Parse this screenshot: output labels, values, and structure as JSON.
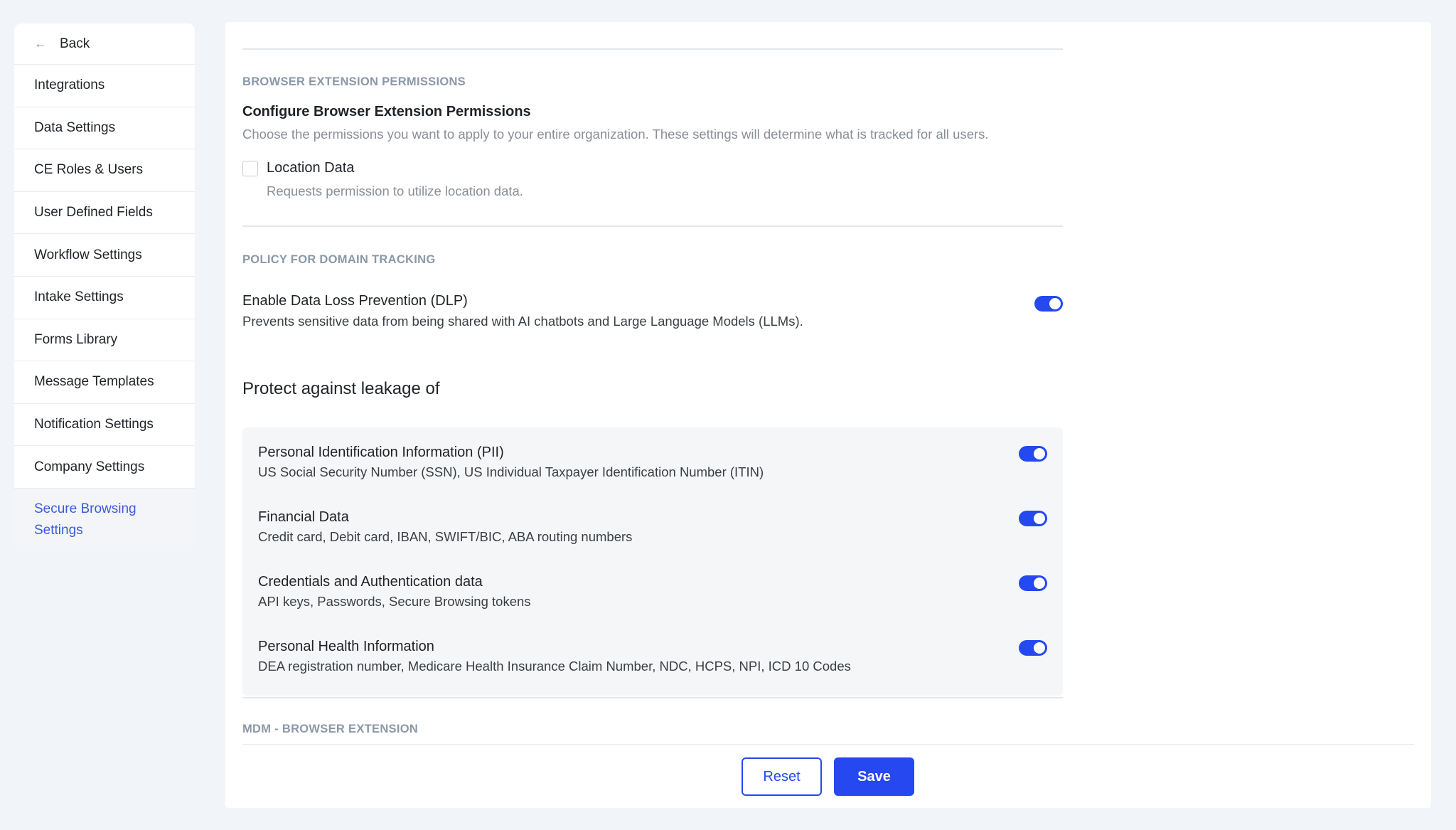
{
  "sidebar": {
    "back_label": "Back",
    "items": [
      {
        "label": "Integrations"
      },
      {
        "label": "Data Settings"
      },
      {
        "label": "CE Roles & Users"
      },
      {
        "label": "User Defined Fields"
      },
      {
        "label": "Workflow Settings"
      },
      {
        "label": "Intake Settings"
      },
      {
        "label": "Forms Library"
      },
      {
        "label": "Message Templates"
      },
      {
        "label": "Notification Settings"
      },
      {
        "label": "Company Settings"
      }
    ],
    "active_item": {
      "line1": "Secure Browsing",
      "line2": "Settings"
    }
  },
  "extension_permissions": {
    "section_label": "BROWSER EXTENSION PERMISSIONS",
    "title": "Configure Browser Extension Permissions",
    "description": "Choose the permissions you want to apply to your entire organization. These settings will determine what is tracked for all users.",
    "location": {
      "label": "Location Data",
      "description": "Requests permission to utilize location data.",
      "checked": false
    }
  },
  "domain_tracking": {
    "section_label": "POLICY FOR DOMAIN TRACKING",
    "dlp": {
      "title": "Enable Data Loss Prevention (DLP)",
      "description": "Prevents sensitive data from being shared with AI chatbots and Large Language Models (LLMs).",
      "enabled": true
    },
    "protect_heading": "Protect against leakage of",
    "items": [
      {
        "title": "Personal Identification Information (PII)",
        "description": "US Social Security Number (SSN), US Individual Taxpayer Identification Number (ITIN)",
        "enabled": true
      },
      {
        "title": "Financial Data",
        "description": "Credit card, Debit card, IBAN, SWIFT/BIC, ABA routing numbers",
        "enabled": true
      },
      {
        "title": "Credentials and Authentication data",
        "description": "API keys, Passwords, Secure Browsing tokens",
        "enabled": true
      },
      {
        "title": "Personal Health Information",
        "description": "DEA registration number, Medicare Health Insurance Claim Number, NDC, HCPS, NPI, ICD 10 Codes",
        "enabled": true
      }
    ]
  },
  "mdm": {
    "section_label": "MDM - BROWSER EXTENSION"
  },
  "footer": {
    "reset_label": "Reset",
    "save_label": "Save"
  },
  "colors": {
    "accent": "#2548f0",
    "active_nav": "#3b5bdb",
    "page_bg": "#f1f4f8"
  }
}
